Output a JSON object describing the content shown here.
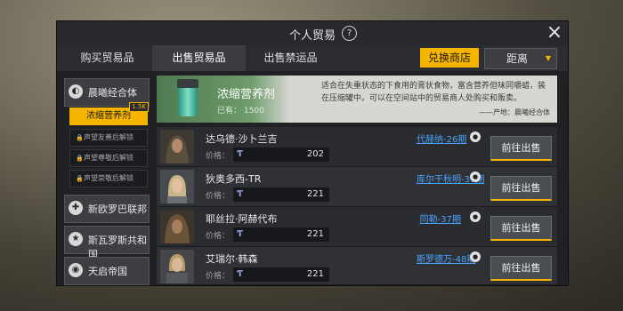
{
  "window": {
    "title": "个人贸易",
    "help_icon": "?",
    "close_icon": "×"
  },
  "tabs": [
    {
      "label": "购买贸易品",
      "active": false
    },
    {
      "label": "出售贸易品",
      "active": true
    },
    {
      "label": "出售禁运品",
      "active": false
    }
  ],
  "toolbar": {
    "shop_button": "兑换商店",
    "distance_select": "距离"
  },
  "sidebar": {
    "factions": [
      {
        "name": "晨曦经合体",
        "icon": "sun-icon"
      },
      {
        "name": "新欧罗巴联邦",
        "icon": "cross-icon"
      },
      {
        "name": "斯瓦罗斯共和国",
        "icon": "star-icon"
      },
      {
        "name": "天启帝国",
        "icon": "eye-icon"
      }
    ],
    "subitems": [
      {
        "label": "浓缩营养剂",
        "selected": true,
        "badge": "1.5K"
      },
      {
        "label": "声望友善后解锁",
        "locked": true
      },
      {
        "label": "声望尊敬后解锁",
        "locked": true
      },
      {
        "label": "声望崇敬后解锁",
        "locked": true
      }
    ]
  },
  "item": {
    "name": "浓缩营养剂",
    "owned_label": "已有：",
    "owned_value": "1500",
    "description": "适合在失重状态的下食用的膏状食物，富含营养但味同嚼蜡，装在压缩罐中。可以在空间站中的贸易商人处购买和贩卖。",
    "origin": "——产地：晨曦经合体"
  },
  "price_label": "价格：",
  "currency_icon": "Ƭ",
  "sell_label": "前往出售",
  "merchants": [
    {
      "name": "达乌德·沙卜兰吉",
      "location": "代赫纳-26期",
      "price": "202"
    },
    {
      "name": "狄奥多西-TR",
      "location": "库尔干秋明-37期",
      "price": "221"
    },
    {
      "name": "耶丝拉·阿赫代布",
      "location": "同勒-37期",
      "price": "221"
    },
    {
      "name": "艾瑞尔·韩森",
      "location": "斯罗德万-48期",
      "price": "221"
    }
  ]
}
